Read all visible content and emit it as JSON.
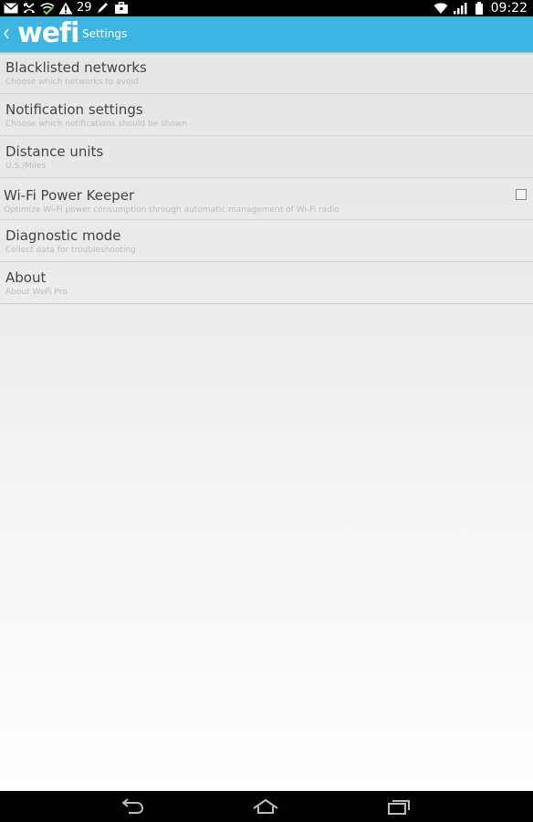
{
  "status_bar": {
    "left_icons": [
      "mail-icon",
      "missed-call-icon",
      "wifi-check-icon",
      "warning-icon"
    ],
    "notification_count": "29",
    "extra_icons": [
      "pencil-icon",
      "briefcase-icon"
    ],
    "right_icons": [
      "wifi-signal-icon",
      "cell-signal-icon",
      "battery-icon"
    ],
    "time": "09:22"
  },
  "action_bar": {
    "logo": "wefi",
    "title": "Settings",
    "color": "#3db5e3"
  },
  "settings": {
    "items": [
      {
        "title": "Blacklisted networks",
        "subtitle": "Choose which networks to avoid"
      },
      {
        "title": "Notification settings",
        "subtitle": "Choose which notifications should be shown"
      },
      {
        "title": "Distance units",
        "subtitle": "U.S./Miles"
      },
      {
        "title": "Wi-Fi Power Keeper",
        "subtitle": "Optimize Wi-Fi power consumption through automatic management of Wi-Fi radio",
        "checked": false
      },
      {
        "title": "Diagnostic mode",
        "subtitle": "Collect data for troubleshooting"
      },
      {
        "title": "About",
        "subtitle": "About WeFi Pro"
      }
    ]
  },
  "nav_bar": {
    "buttons": [
      "back-icon",
      "home-icon",
      "recent-apps-icon"
    ]
  }
}
